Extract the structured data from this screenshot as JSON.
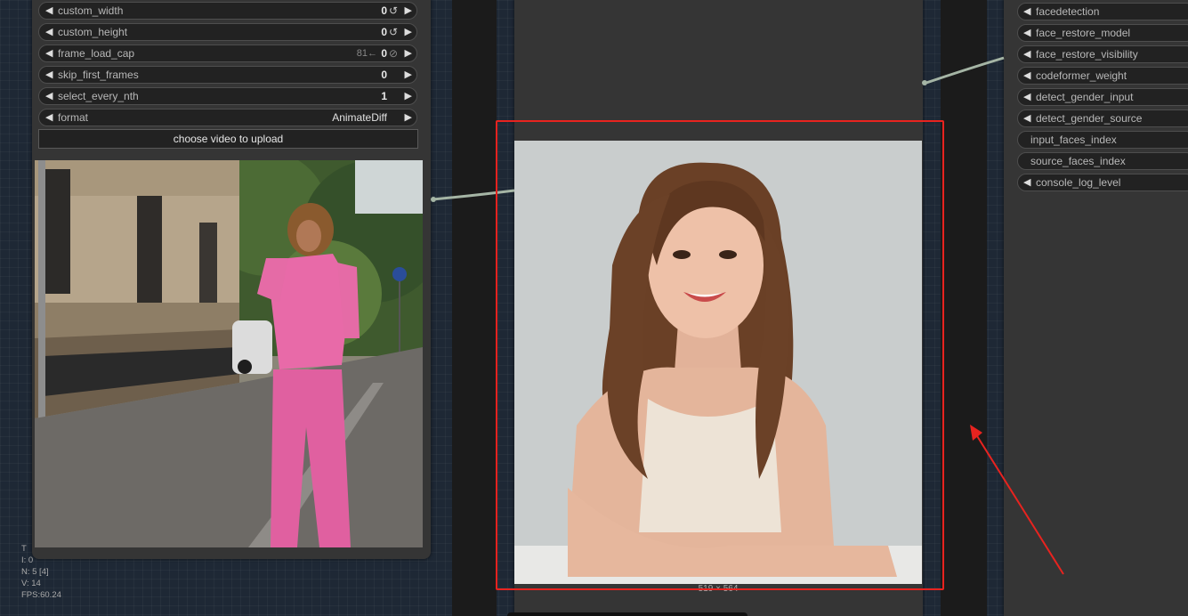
{
  "left_node": {
    "widgets": [
      {
        "name": "custom_width",
        "value": "0",
        "extra": "",
        "reset": "↺"
      },
      {
        "name": "custom_height",
        "value": "0",
        "extra": "",
        "reset": "↺"
      },
      {
        "name": "frame_load_cap",
        "value": "0",
        "extra": "81←",
        "reset": "⊘"
      },
      {
        "name": "skip_first_frames",
        "value": "0",
        "extra": "",
        "reset": ""
      },
      {
        "name": "select_every_nth",
        "value": "1",
        "extra": "",
        "reset": ""
      },
      {
        "name": "format",
        "value": "AnimateDiff",
        "extra": "",
        "reset": ""
      }
    ],
    "upload_label": "choose video to upload"
  },
  "center_node": {
    "image_size": "519 × 564"
  },
  "right_node": {
    "inputs": [
      {
        "name": "facedetection",
        "arrow": true
      },
      {
        "name": "face_restore_model",
        "arrow": true
      },
      {
        "name": "face_restore_visibility",
        "arrow": true
      },
      {
        "name": "codeformer_weight",
        "arrow": true
      },
      {
        "name": "detect_gender_input",
        "arrow": true
      },
      {
        "name": "detect_gender_source",
        "arrow": true
      },
      {
        "name": "input_faces_index",
        "arrow": false
      },
      {
        "name": "source_faces_index",
        "arrow": false
      },
      {
        "name": "console_log_level",
        "arrow": true
      }
    ]
  },
  "stats": {
    "t": "T",
    "i": "I: 0",
    "n": "N: 5 [4]",
    "v": "V: 14",
    "fps": "FPS:60.24"
  },
  "icons": {
    "arrow_left": "◀",
    "arrow_right": "▶"
  },
  "colors": {
    "canvas_bg": "#1e2835",
    "node_bg": "#353535",
    "highlight": "#e8231f",
    "link": "#a5b5a5"
  }
}
